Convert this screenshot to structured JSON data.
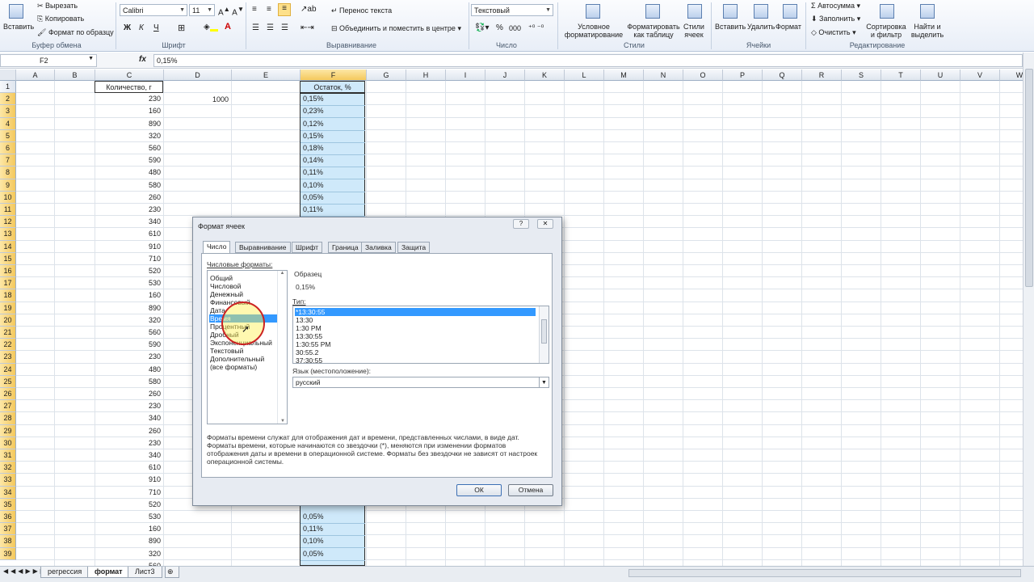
{
  "ribbon": {
    "clipboard": {
      "paste": "Вставить",
      "cut": "Вырезать",
      "copy": "Копировать",
      "format_painter": "Формат по образцу",
      "group": "Буфер обмена"
    },
    "font": {
      "name": "Calibri",
      "size": "11",
      "bold": "Ж",
      "italic": "К",
      "underline": "Ч",
      "group": "Шрифт"
    },
    "alignment": {
      "wrap": "Перенос текста",
      "merge": "Объединить и поместить в центре",
      "group": "Выравнивание"
    },
    "number": {
      "format": "Текстовый",
      "percent": "%",
      "thousands": "000",
      "group": "Число"
    },
    "styles": {
      "conditional_1": "Условное",
      "conditional_2": "форматирование",
      "as_table_1": "Форматировать",
      "as_table_2": "как таблицу",
      "cell_styles_1": "Стили",
      "cell_styles_2": "ячеек",
      "group": "Стили"
    },
    "cells": {
      "insert": "Вставить",
      "delete": "Удалить",
      "format": "Формат",
      "group": "Ячейки"
    },
    "editing": {
      "autosum": "Автосумма",
      "fill": "Заполнить",
      "clear": "Очистить",
      "sort_1": "Сортировка",
      "sort_2": "и фильтр",
      "find_1": "Найти и",
      "find_2": "выделить",
      "group": "Редактирование"
    }
  },
  "formula_bar": {
    "name_box": "F2",
    "fx": "fx",
    "value": "0,15%"
  },
  "columns": [
    "A",
    "B",
    "C",
    "D",
    "E",
    "F",
    "G",
    "H",
    "I",
    "J",
    "K",
    "L",
    "M",
    "N",
    "O",
    "P",
    "Q",
    "R",
    "S",
    "T",
    "U",
    "V",
    "W"
  ],
  "rows": [
    "1",
    "2",
    "3",
    "4",
    "5",
    "6",
    "7",
    "8",
    "9",
    "10",
    "11",
    "12",
    "13",
    "14",
    "15",
    "16",
    "17",
    "18",
    "19",
    "20",
    "21",
    "22",
    "23",
    "24",
    "25",
    "26",
    "27",
    "28",
    "29",
    "30",
    "31",
    "32",
    "33",
    "34",
    "35",
    "36",
    "37",
    "38",
    "39"
  ],
  "cells": {
    "c1": "Количество, г",
    "f1": "Остаток, %",
    "d2": "1000",
    "colC": [
      "230",
      "160",
      "890",
      "320",
      "560",
      "590",
      "480",
      "580",
      "260",
      "230",
      "340",
      "610",
      "910",
      "710",
      "520",
      "530",
      "160",
      "890",
      "320",
      "560",
      "590",
      "230",
      "480",
      "580",
      "260",
      "230",
      "340",
      "260",
      "230",
      "340",
      "610",
      "910",
      "710",
      "520",
      "530",
      "160",
      "890",
      "320",
      "560"
    ],
    "colF_top": [
      "0,15%",
      "0,23%",
      "0,12%",
      "0,15%",
      "0,18%",
      "0,14%",
      "0,11%",
      "0,10%",
      "0,05%",
      "0,11%"
    ],
    "colF_bottom": [
      "0,05%",
      "0,11%",
      "0,10%",
      "0,05%"
    ]
  },
  "sheet_tabs": [
    "регрессия",
    "формат",
    "Лист3"
  ],
  "dialog": {
    "title": "Формат ячеек",
    "tabs": [
      "Число",
      "Выравнивание",
      "Шрифт",
      "Граница",
      "Заливка",
      "Защита"
    ],
    "formats_label": "Числовые форматы:",
    "categories": [
      "Общий",
      "Числовой",
      "Денежный",
      "Финансовый",
      "Дата",
      "Время",
      "Процентный",
      "Дробный",
      "Экспоненциальный",
      "Текстовый",
      "Дополнительный",
      "(все форматы)"
    ],
    "sample_label": "Образец",
    "sample_value": "0,15%",
    "type_label": "Тип:",
    "types": [
      "*13:30:55",
      "13:30",
      "1:30 PM",
      "13:30:55",
      "1:30:55 PM",
      "30:55.2",
      "37:30:55"
    ],
    "lang_label": "Язык (местоположение):",
    "lang_value": "русский",
    "description": "Форматы времени служат для отображения дат и времени, представленных числами, в виде дат. Форматы времени, которые начинаются со звездочки (*), меняются при изменении форматов отображения даты и времени в операционной системе. Форматы без звездочки не зависят от настроек операционной системы.",
    "ok": "ОК",
    "cancel": "Отмена"
  },
  "colors": {
    "accent": "#3399ff",
    "selection": "#cfe9fa",
    "header_highlight": "#f4c85c"
  }
}
